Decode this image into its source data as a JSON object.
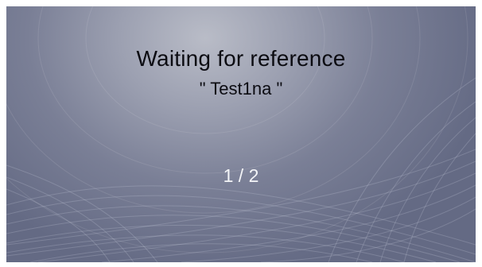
{
  "screen": {
    "title": "Waiting for reference",
    "reference_display": "\" Test1na \"",
    "progress_display": "1 / 2"
  },
  "colors": {
    "background_light": "#b9bcc7",
    "background_dark": "#646a84",
    "title_text": "#0c0c12",
    "counter_text": "#f4f5f8"
  }
}
